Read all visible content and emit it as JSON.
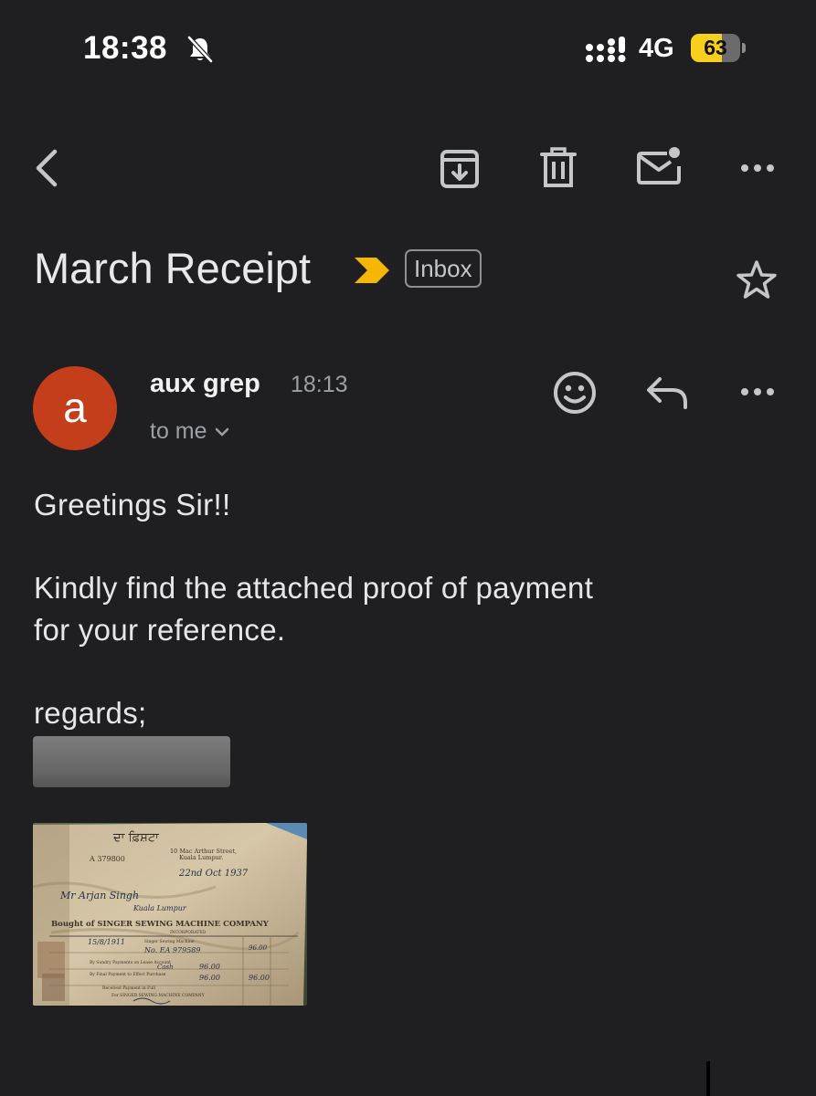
{
  "status_bar": {
    "time": "18:38",
    "network": "4G",
    "battery": "63",
    "battery_level": 0.63,
    "icons": [
      "bell-slash-icon",
      "signal-icon"
    ]
  },
  "toolbar": {
    "icons": [
      "back-icon",
      "archive-icon",
      "delete-icon",
      "mark-unread-icon",
      "more-icon"
    ]
  },
  "email": {
    "subject": "March Receipt",
    "label": "Inbox",
    "importance_color": "#f6b704",
    "sender": {
      "initial": "a",
      "name": "aux grep",
      "time": "18:13",
      "recipients": "to me",
      "avatar_color": "#c43e1c"
    },
    "body": {
      "greeting": "Greetings Sir!!",
      "line1": "Kindly find the attached proof of payment",
      "line2": "for your reference.",
      "closing": "regards;"
    },
    "attachment": {
      "type": "image",
      "receipt_text": {
        "serial": "A 379800",
        "address_line1": "10 Mac Arthur Street,",
        "address_line2": "Kuala Lumpur.",
        "date": "22nd Oct 1937",
        "customer": "Mr Arjan Singh",
        "customer_location": "Kuala Lumpur",
        "bought_of": "Bought of SINGER SEWING MACHINE COMPANY",
        "incorporated": "INCORPORATED",
        "item_date": "15/8/1911",
        "item_desc": "Singer Sewing Machine",
        "machine_no": "No. EA 979589",
        "price": "96.00",
        "line_credit": "By Sundry Payments on Lease Account",
        "line_final": "By Final Payment to Effect Purchase",
        "cash_label": "Cash",
        "cash_amount": "96.00",
        "total1": "96.00",
        "total2": "96.00",
        "received": "Received Payment in Full",
        "for_company": "For SINGER SEWING MACHINE COMPANY"
      }
    }
  },
  "colors": {
    "background": "#1f1f21",
    "icon": "#c4c7c5",
    "secondary_text": "#9aa0a6",
    "battery": "#f7cf1d"
  }
}
